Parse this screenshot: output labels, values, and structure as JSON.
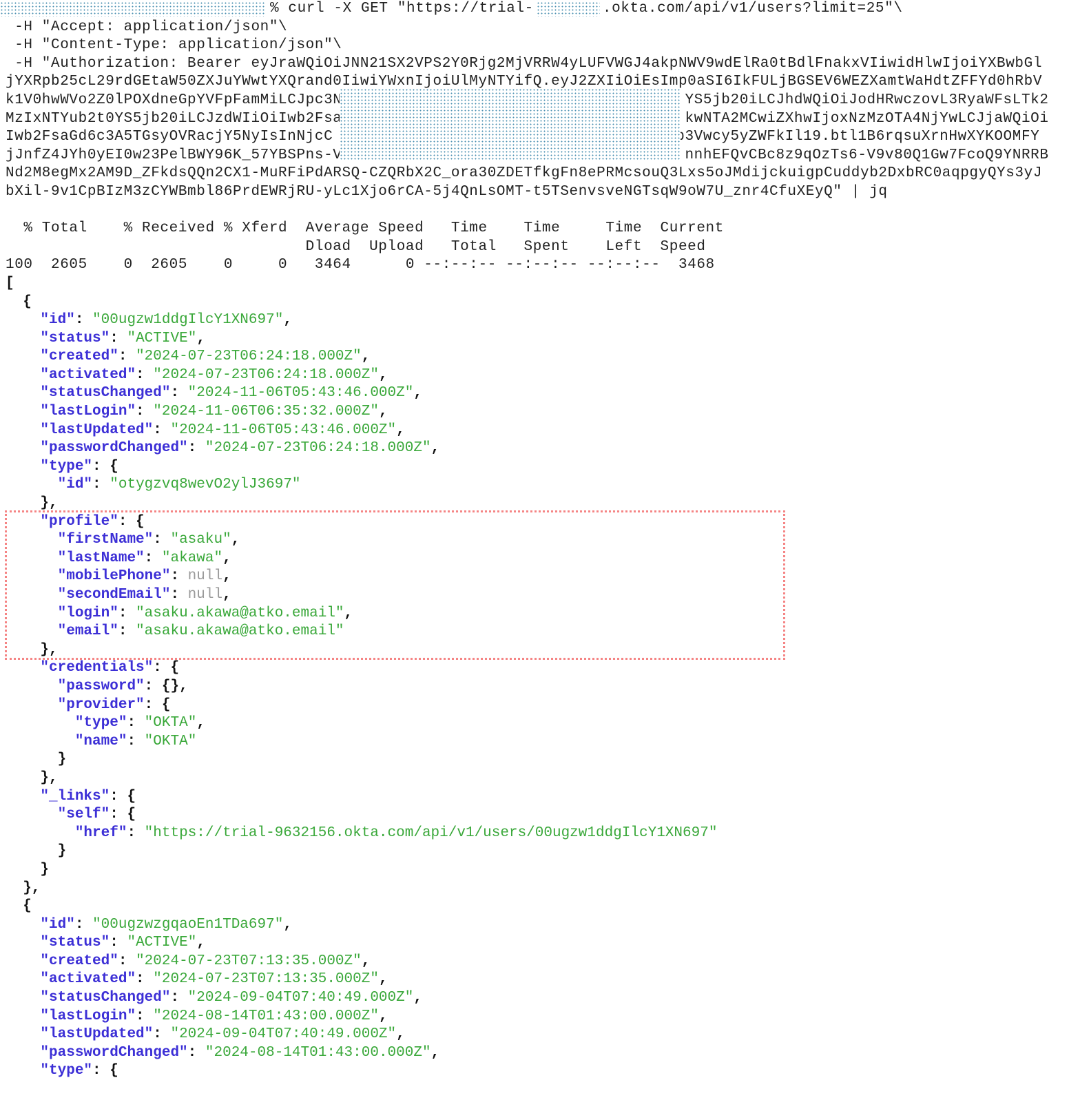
{
  "command": {
    "prompt_symbol": "%",
    "curl_line": "curl -X GET \"https://trial-",
    "url_suffix": ".okta.com/api/v1/users?limit=25\"\\",
    "header_accept": " -H \"Accept: application/json\"\\",
    "header_content_type": " -H \"Content-Type: application/json\"\\",
    "header_auth": " -H \"Authorization: Bearer eyJraWQiOiJNN21SX2VPS2Y0Rjg2MjVRRW4yLUFVWGJ4akpNWV9wdElRa0tBdlFnakxVIiwidHlwIjoiYXBwbGl",
    "token_lines_left": [
      "jYXRpb25cL29rdGEtaW50ZXJuYWwtYXQrand0IiwiYWxnIjoiUlMyNTYifQ.eyJ2ZXIiOiEsImp0aSI6IkFULjBGSEV6WEZXamtWaHdtZFFYd0hRbV",
      "k1V0hwWVo2Z0lPOXdneGpYVFpFamMiLCJpc3N",
      "MzIxNTYub2t0YS5jb20iLCJzdWIiOiIwb2Fsa",
      "Iwb2FsaGd6c3A5TGsyOVRacjY5NyIsInNjcC",
      "jJnfZ4JYh0yEI0w23PelBWY96K_57YBSPns-V",
      "Nd2M8egMx2AM9D_ZFkdsQQn2CX1-MuRFiPdARSQ-CZQRbX2C_ora30ZDETfkgFn8ePRMcsouQ3Lxs5oJMdijckuigpCuddyb2DxbRC0aqpgyQYs3yJ",
      "bXil-9v1CpBIzM3zCYWBmbl86PrdEWRjRU-yLc1Xjo6rCA-5j4QnLsOMT-t5TSenvsveNGTsqW9oW7U_znr4CfuXEyQ\" | jq"
    ],
    "token_lines_right": [
      "YS5jb20iLCJhdWQiOiJodHRwczovL3RyaWFsLTk2",
      "kwNTA2MCwiZXhwIjoxNzMzOTA4NjYwLCJjaWQiOi",
      "b3Vwcy5yZWFkIl19.btl1B6rqsuXrnHwXYKOOMFY",
      "nnhEFQvCBc8z9qOzTs6-V9v80Q1Gw7FcoQ9YNRRB"
    ]
  },
  "progress": {
    "header1": "  % Total    % Received % Xferd  Average Speed   Time    Time     Time  Current",
    "header2": "                                 Dload  Upload   Total   Spent    Left  Speed",
    "values": "100  2605    0  2605    0     0   3464      0 --:--:-- --:--:-- --:--:--  3468"
  },
  "users": [
    {
      "id": "00ugzw1ddgIlcY1XN697",
      "status": "ACTIVE",
      "created": "2024-07-23T06:24:18.000Z",
      "activated": "2024-07-23T06:24:18.000Z",
      "statusChanged": "2024-11-06T05:43:46.000Z",
      "lastLogin": "2024-11-06T06:35:32.000Z",
      "lastUpdated": "2024-11-06T05:43:46.000Z",
      "passwordChanged": "2024-07-23T06:24:18.000Z",
      "type_id": "otygzvq8wevO2ylJ3697",
      "profile": {
        "firstName": "asaku",
        "lastName": "akawa",
        "mobilePhone": "null",
        "secondEmail": "null",
        "login": "asaku.akawa@atko.email",
        "email": "asaku.akawa@atko.email"
      },
      "credentials": {
        "password": "{}",
        "provider_type": "OKTA",
        "provider_name": "OKTA"
      },
      "links_self_href": "https://trial-9632156.okta.com/api/v1/users/00ugzw1ddgIlcY1XN697"
    },
    {
      "id": "00ugzwzgqaoEn1TDa697",
      "status": "ACTIVE",
      "created": "2024-07-23T07:13:35.000Z",
      "activated": "2024-07-23T07:13:35.000Z",
      "statusChanged": "2024-09-04T07:40:49.000Z",
      "lastLogin": "2024-08-14T01:43:00.000Z",
      "lastUpdated": "2024-09-04T07:40:49.000Z",
      "passwordChanged": "2024-08-14T01:43:00.000Z"
    }
  ],
  "colors": {
    "json_key": "#3c2fd6",
    "json_string": "#3aa83a",
    "json_null": "#9a9a9a",
    "highlight_border": "#f58585"
  }
}
